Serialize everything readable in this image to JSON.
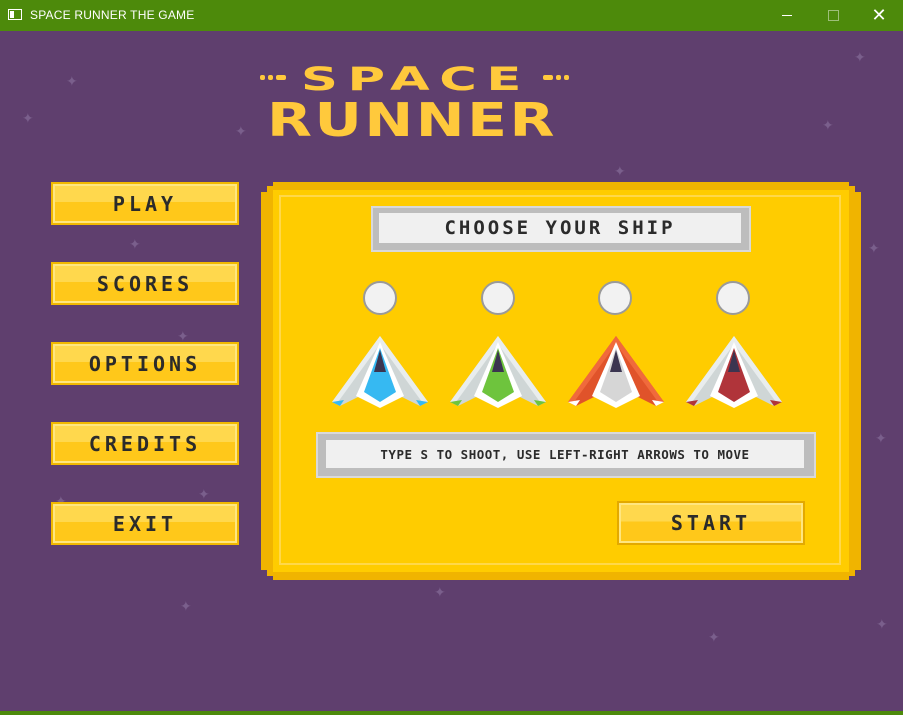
{
  "window": {
    "title": "SPACE RUNNER THE GAME",
    "minimize_glyph": "",
    "maximize_glyph": "",
    "close_glyph": "✕"
  },
  "logo": {
    "line1": "SPACE",
    "line2": "RUNNER",
    "color": "#ffc93c"
  },
  "menu": {
    "items": [
      {
        "label": "PLAY"
      },
      {
        "label": "SCORES"
      },
      {
        "label": "OPTIONS"
      },
      {
        "label": "CREDITS"
      },
      {
        "label": "EXIT"
      }
    ]
  },
  "panel": {
    "heading": "CHOOSE YOUR SHIP",
    "ships": [
      {
        "name": "blue-ship",
        "color": "#36b9f2"
      },
      {
        "name": "green-ship",
        "color": "#6ec43d"
      },
      {
        "name": "orange-ship",
        "color": "#e0532a"
      },
      {
        "name": "red-ship",
        "color": "#b0343a"
      }
    ],
    "hint": "TYPE S TO SHOOT, USE LEFT-RIGHT ARROWS TO MOVE",
    "start_label": "START"
  },
  "colors": {
    "background": "#5f3f6e",
    "titlebar": "#4d8a0b",
    "accent_yellow": "#ffcc00"
  }
}
